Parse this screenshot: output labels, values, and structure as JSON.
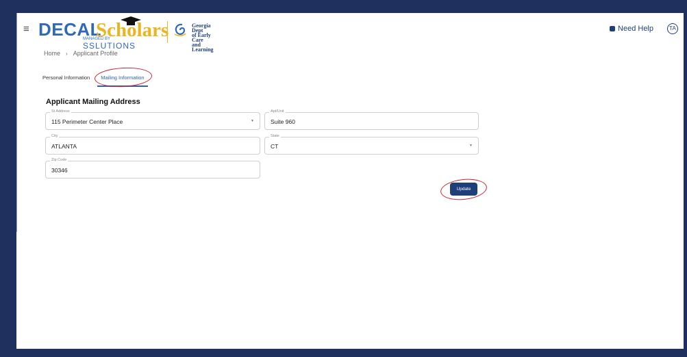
{
  "header": {
    "menu_icon": "hamburger-menu-icon",
    "logo": {
      "decal": "DECAL",
      "scholars": "Scholars",
      "managed_by": "MANAGED BY",
      "managed_company": "SSLUTIONS"
    },
    "partner": {
      "line1": "Georgia Dept",
      "line2": "of Early Care",
      "line3": "and Learning"
    },
    "help_label": "Need Help",
    "avatar_initials": "TA"
  },
  "breadcrumb": {
    "home": "Home",
    "separator": "›",
    "current": "Applicant Profile"
  },
  "tabs": [
    {
      "label": "Personal Information",
      "active": false
    },
    {
      "label": "Mailing Information",
      "active": true
    }
  ],
  "form": {
    "title": "Applicant Mailing Address",
    "st_address": {
      "label": "St Address",
      "value": "115 Perimeter Center Place"
    },
    "apt_unit": {
      "label": "Apt/Unit",
      "value": "Suite 960"
    },
    "city": {
      "label": "City",
      "value": "ATLANTA"
    },
    "state": {
      "label": "State",
      "value": "CT"
    },
    "zip": {
      "label": "Zip Code",
      "value": "30346"
    },
    "update_label": "Update"
  },
  "colors": {
    "frame_background": "#1f2f5e",
    "primary": "#1f3f7a",
    "accent_gold": "#e9b521",
    "annotation_red": "#cc2233"
  }
}
